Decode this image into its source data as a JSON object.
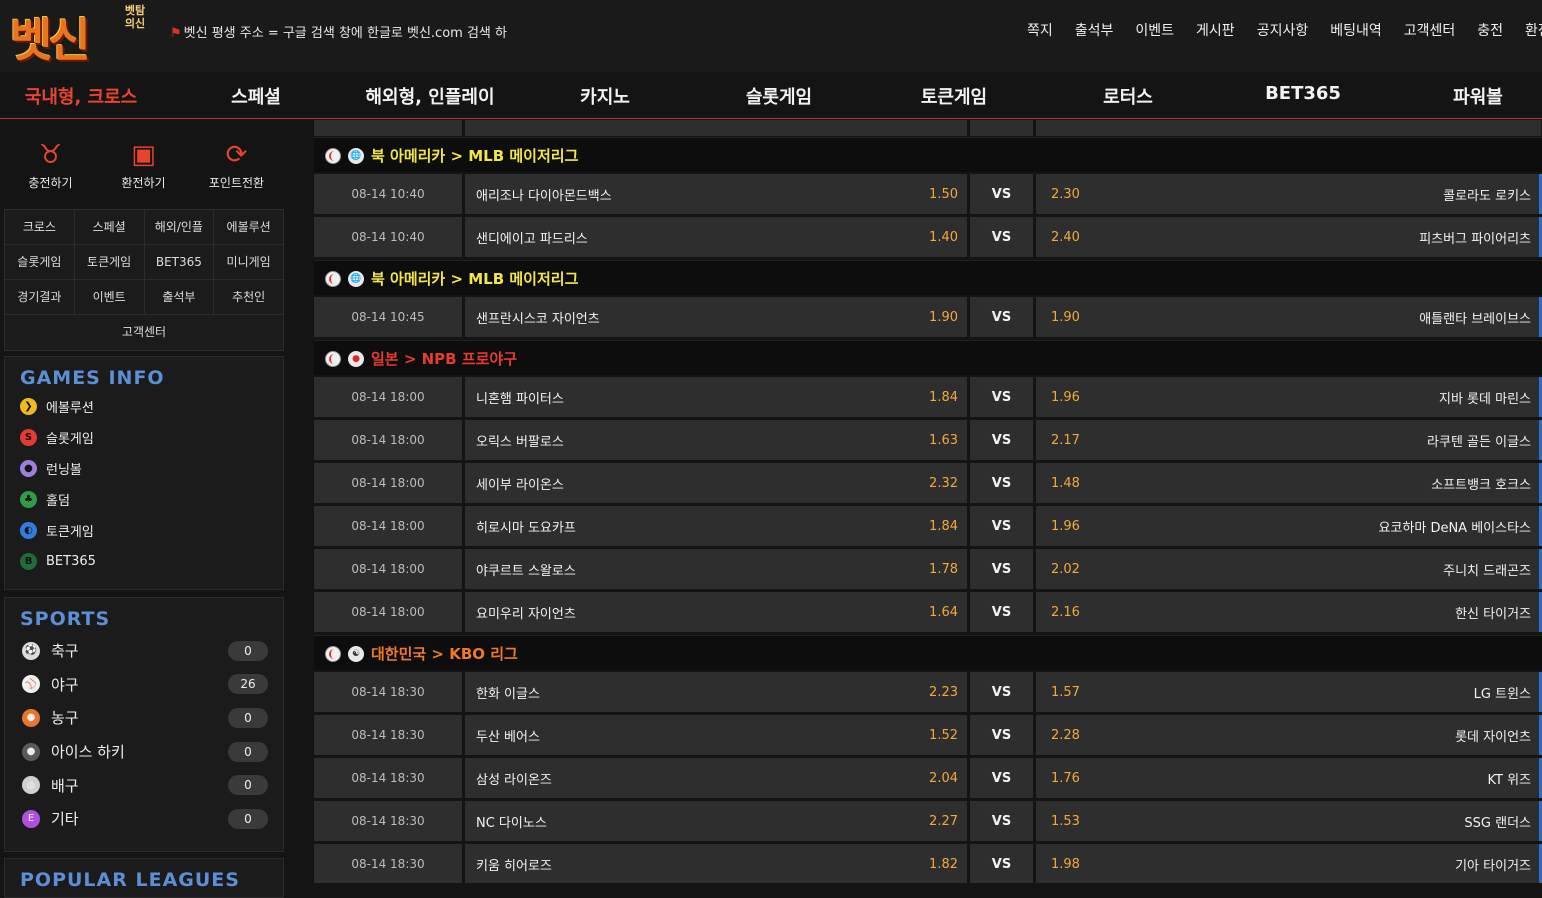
{
  "logo": {
    "main": "벳신",
    "sub": "벳탐의신"
  },
  "notice": "벳신 평생 주소 = 구글 검색 창에 한글로 벳신.com 검색 하",
  "topmenu": [
    "쪽지",
    "출석부",
    "이벤트",
    "게시판",
    "공지사항",
    "베팅내역",
    "고객센터",
    "충전",
    "환전"
  ],
  "mainnav": [
    "국내형, 크로스",
    "스페셜",
    "해외형, 인플레이",
    "카지노",
    "슬롯게임",
    "토큰게임",
    "로터스",
    "BET365",
    "파워볼"
  ],
  "quick": [
    {
      "label": "충전하기",
      "icon": "piggy-bank-icon"
    },
    {
      "label": "환전하기",
      "icon": "cash-register-icon"
    },
    {
      "label": "포인트전환",
      "icon": "refresh-icon"
    }
  ],
  "gridmenu": [
    [
      "크로스",
      "스페셜",
      "해외/인플",
      "에볼루션"
    ],
    [
      "슬롯게임",
      "토큰게임",
      "BET365",
      "미니게임"
    ],
    [
      "경기결과",
      "이벤트",
      "출석부",
      "추천인"
    ],
    [
      "고객센터"
    ]
  ],
  "games_info": {
    "title": "GAMES INFO",
    "items": [
      {
        "label": "에볼루션",
        "color": "#f0b91e",
        "glyph": "❯"
      },
      {
        "label": "슬롯게임",
        "color": "#e53935",
        "glyph": "S"
      },
      {
        "label": "런닝볼",
        "color": "#9b7fd8",
        "glyph": "●"
      },
      {
        "label": "홀덤",
        "color": "#2e9d4a",
        "glyph": "♣"
      },
      {
        "label": "토큰게임",
        "color": "#2f7de0",
        "glyph": "◐"
      },
      {
        "label": "BET365",
        "color": "#1f6b3c",
        "glyph": "B"
      }
    ]
  },
  "sports": {
    "title": "SPORTS",
    "items": [
      {
        "label": "축구",
        "count": "0",
        "icon": "soccer-ball-icon",
        "color": "#dcdcdc",
        "glyph": "⚽"
      },
      {
        "label": "야구",
        "count": "26",
        "icon": "baseball-icon",
        "color": "#f2f2f2",
        "glyph": "⚾"
      },
      {
        "label": "농구",
        "count": "0",
        "icon": "basketball-icon",
        "color": "#e8762a",
        "glyph": "●"
      },
      {
        "label": "아이스 하키",
        "count": "0",
        "icon": "hockey-puck-icon",
        "color": "#5a5a5a",
        "glyph": "●"
      },
      {
        "label": "배구",
        "count": "0",
        "icon": "volleyball-icon",
        "color": "#cfcfcf",
        "glyph": "◍"
      },
      {
        "label": "기타",
        "count": "0",
        "icon": "etc-icon",
        "color": "#b04fe0",
        "glyph": "E"
      }
    ]
  },
  "popular": {
    "title": "POPULAR LEAGUES"
  },
  "leagues": [
    {
      "name": "북 아메리카 > MLB 메이저리그",
      "color": "#f2e74a",
      "flag": "globe",
      "games": [
        {
          "time": "08-14 10:40",
          "home": "애리조나 다이아몬드백스",
          "home_odd": "1.50",
          "vs": "VS",
          "away_odd": "2.30",
          "away": "콜로라도 로키스"
        },
        {
          "time": "08-14 10:40",
          "home": "샌디에이고 파드리스",
          "home_odd": "1.40",
          "vs": "VS",
          "away_odd": "2.40",
          "away": "피츠버그 파이어리츠"
        }
      ]
    },
    {
      "name": "북 아메리카 > MLB 메이저리그",
      "color": "#f2e74a",
      "flag": "globe",
      "games": [
        {
          "time": "08-14 10:45",
          "home": "샌프란시스코 자이언츠",
          "home_odd": "1.90",
          "vs": "VS",
          "away_odd": "1.90",
          "away": "애틀랜타 브레이브스"
        }
      ]
    },
    {
      "name": "일본 > NPB 프로야구",
      "color": "#e83a2f",
      "flag": "japan",
      "games": [
        {
          "time": "08-14 18:00",
          "home": "니혼햄 파이터스",
          "home_odd": "1.84",
          "vs": "VS",
          "away_odd": "1.96",
          "away": "지바 롯데 마린스"
        },
        {
          "time": "08-14 18:00",
          "home": "오릭스 버팔로스",
          "home_odd": "1.63",
          "vs": "VS",
          "away_odd": "2.17",
          "away": "라쿠텐 골든 이글스"
        },
        {
          "time": "08-14 18:00",
          "home": "세이부 라이온스",
          "home_odd": "2.32",
          "vs": "VS",
          "away_odd": "1.48",
          "away": "소프트뱅크 호크스"
        },
        {
          "time": "08-14 18:00",
          "home": "히로시마 도요카프",
          "home_odd": "1.84",
          "vs": "VS",
          "away_odd": "1.96",
          "away": "요코하마 DeNA 베이스타스"
        },
        {
          "time": "08-14 18:00",
          "home": "야쿠르트 스왈로스",
          "home_odd": "1.78",
          "vs": "VS",
          "away_odd": "2.02",
          "away": "주니치 드래곤즈"
        },
        {
          "time": "08-14 18:00",
          "home": "요미우리 자이언츠",
          "home_odd": "1.64",
          "vs": "VS",
          "away_odd": "2.16",
          "away": "한신 타이거즈"
        }
      ]
    },
    {
      "name": "대한민국 > KBO 리그",
      "color": "#f07a2a",
      "flag": "korea",
      "games": [
        {
          "time": "08-14 18:30",
          "home": "한화 이글스",
          "home_odd": "2.23",
          "vs": "VS",
          "away_odd": "1.57",
          "away": "LG 트윈스"
        },
        {
          "time": "08-14 18:30",
          "home": "두산 베어스",
          "home_odd": "1.52",
          "vs": "VS",
          "away_odd": "2.28",
          "away": "롯데 자이언츠"
        },
        {
          "time": "08-14 18:30",
          "home": "삼성 라이온즈",
          "home_odd": "2.04",
          "vs": "VS",
          "away_odd": "1.76",
          "away": "KT 위즈"
        },
        {
          "time": "08-14 18:30",
          "home": "NC 다이노스",
          "home_odd": "2.27",
          "vs": "VS",
          "away_odd": "1.53",
          "away": "SSG 랜더스"
        },
        {
          "time": "08-14 18:30",
          "home": "키움 히어로즈",
          "home_odd": "1.82",
          "vs": "VS",
          "away_odd": "1.98",
          "away": "기아 타이거즈"
        }
      ]
    }
  ]
}
